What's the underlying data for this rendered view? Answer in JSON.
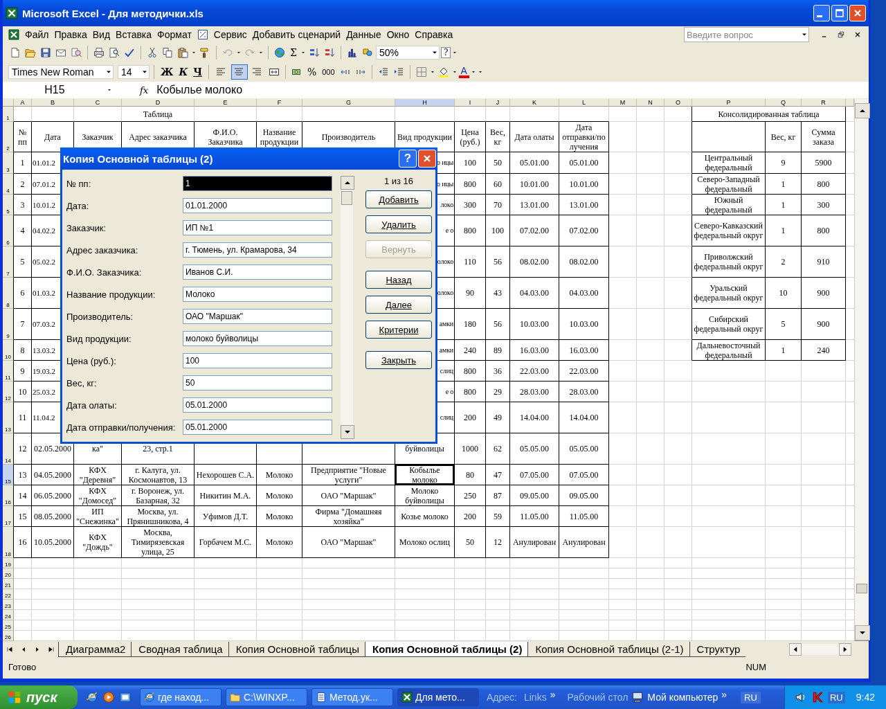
{
  "window": {
    "title": "Microsoft Excel - Для методички.xls"
  },
  "menu": [
    "Файл",
    "Правка",
    "Вид",
    "Вставка",
    "Формат",
    "Сервис",
    "Добавить сценарий",
    "Данные",
    "Окно",
    "Справка"
  ],
  "help_search": {
    "placeholder": "Введите вопрос"
  },
  "toolbar": {
    "sum": "Σ",
    "zoom": "50%",
    "help": "?",
    "font": "Times New Roman",
    "size": "14",
    "bold": "Ж",
    "italic": "К",
    "underline": "Ч",
    "percent": "%",
    "thousands": "000",
    "font_color": "A",
    "alignment": [
      {
        "kind": "left",
        "selected": false
      },
      {
        "kind": "center",
        "selected": true
      },
      {
        "kind": "right",
        "selected": false
      }
    ]
  },
  "formula_bar": {
    "name_box": "H15",
    "fx": "fx",
    "formula": "Кобылье молоко"
  },
  "sheet": {
    "columns": [
      {
        "label": "A",
        "selected": false
      },
      {
        "label": "B",
        "selected": false
      },
      {
        "label": "C",
        "selected": false
      },
      {
        "label": "D",
        "selected": false
      },
      {
        "label": "E",
        "selected": false
      },
      {
        "label": "F",
        "selected": false
      },
      {
        "label": "G",
        "selected": false
      },
      {
        "label": "H",
        "selected": true
      },
      {
        "label": "I",
        "selected": false
      },
      {
        "label": "J",
        "selected": false
      },
      {
        "label": "K",
        "selected": false
      },
      {
        "label": "L",
        "selected": false
      },
      {
        "label": "M",
        "selected": false
      },
      {
        "label": "N",
        "selected": false
      },
      {
        "label": "O",
        "selected": false
      },
      {
        "label": "P",
        "selected": false
      },
      {
        "label": "Q",
        "selected": false
      },
      {
        "label": "R",
        "selected": false
      }
    ],
    "rows": [
      {
        "label": "1",
        "selected": false,
        "cells": {
          "d": "Таблица",
          "p": "Консолидированная таблица"
        }
      },
      {
        "label": "2",
        "selected": false,
        "cells": {
          "a": "№ пп",
          "b": "Дата",
          "c": "Заказчик",
          "d": "Адрес заказчика",
          "e": "Ф.И.О. Заказчика",
          "f": "Название продукции",
          "g": "Производитель",
          "h": "Вид продукции",
          "i": "Цена (руб.)",
          "j": "Вес, кг",
          "k": "Дата олаты",
          "l": "Дата отправки/по лучения",
          "q": "Вес, кг",
          "r": "Сумма заказа"
        }
      },
      {
        "label": "3",
        "selected": false,
        "cells": {
          "a": "1",
          "b": "01.01.2",
          "h": "о ицы",
          "i": "100",
          "j": "50",
          "k": "05.01.00",
          "l": "05.01.00",
          "p": "Центральный федеральный",
          "q": "9",
          "r": "5900"
        }
      },
      {
        "label": "4",
        "selected": false,
        "cells": {
          "a": "2",
          "b": "07.01.2",
          "h": "о ицы",
          "i": "800",
          "j": "60",
          "k": "10.01.00",
          "l": "10.01.00",
          "p": "Северо-Западный федеральный",
          "q": "1",
          "r": "800"
        }
      },
      {
        "label": "5",
        "selected": false,
        "cells": {
          "a": "3",
          "b": "10.01.2",
          "h": "локо",
          "i": "300",
          "j": "70",
          "k": "13.01.00",
          "l": "13.01.00",
          "p": "Южный федеральный",
          "q": "1",
          "r": "300"
        }
      },
      {
        "label": "6",
        "selected": false,
        "cells": {
          "a": "4",
          "b": "04.02.2",
          "h": "е о",
          "i": "800",
          "j": "100",
          "k": "07.02.00",
          "l": "07.02.00",
          "p": "Северо-Кавказский федеральный округ",
          "q": "1",
          "r": "800"
        }
      },
      {
        "label": "7",
        "selected": false,
        "cells": {
          "a": "5",
          "b": "05.02.2",
          "h": "олоко",
          "i": "110",
          "j": "56",
          "k": "08.02.00",
          "l": "08.02.00",
          "p": "Приволжский федеральный округ",
          "q": "2",
          "r": "910"
        }
      },
      {
        "label": "8",
        "selected": false,
        "cells": {
          "a": "6",
          "b": "01.03.2",
          "h": "олоко",
          "i": "90",
          "j": "43",
          "k": "04.03.00",
          "l": "04.03.00",
          "p": "Уральский федеральный округ",
          "q": "10",
          "r": "900"
        }
      },
      {
        "label": "9",
        "selected": false,
        "cells": {
          "a": "7",
          "b": "07.03.2",
          "h": "амки",
          "i": "180",
          "j": "56",
          "k": "10.03.00",
          "l": "10.03.00",
          "p": "Сибирский федеральный округ",
          "q": "5",
          "r": "900"
        }
      },
      {
        "label": "10",
        "selected": false,
        "cells": {
          "a": "8",
          "b": "13.03.2",
          "h": "амки",
          "i": "240",
          "j": "89",
          "k": "16.03.00",
          "l": "16.03.00",
          "p": "Дальневосточный федеральный",
          "q": "1",
          "r": "240"
        }
      },
      {
        "label": "11",
        "selected": false,
        "cells": {
          "a": "9",
          "b": "19.03.2",
          "h": "слиц",
          "i": "800",
          "j": "36",
          "k": "22.03.00",
          "l": "22.03.00"
        }
      },
      {
        "label": "12",
        "selected": false,
        "cells": {
          "a": "10",
          "b": "25.03.2",
          "h": "е о",
          "i": "800",
          "j": "29",
          "k": "28.03.00",
          "l": "28.03.00"
        }
      },
      {
        "label": "13",
        "selected": false,
        "cells": {
          "a": "11",
          "b": "11.04.2",
          "h": "слиц",
          "i": "200",
          "j": "49",
          "k": "14.04.00",
          "l": "14.04.00"
        }
      },
      {
        "label": "14",
        "selected": false,
        "cells": {
          "a": "12",
          "b": "02.05.2000",
          "c": "ка\"",
          "d": "23, стр.1",
          "h": "буйволицы",
          "i": "1000",
          "j": "62",
          "k": "05.05.00",
          "l": "05.05.00"
        }
      },
      {
        "label": "15",
        "selected": true,
        "cells": {
          "a": "13",
          "b": "04.05.2000",
          "c": "КФХ \"Деревня\"",
          "d": "г. Калуга, ул. Космонавтов, 13",
          "e": "Нехорошев С.А.",
          "f": "Молоко",
          "g": "Предприятие \"Новые услуги\"",
          "h": "Кобылье молоко",
          "i": "80",
          "j": "47",
          "k": "07.05.00",
          "l": "07.05.00"
        }
      },
      {
        "label": "16",
        "selected": false,
        "cells": {
          "a": "14",
          "b": "06.05.2000",
          "c": "КФХ \"Домосед\"",
          "d": "г. Воронеж, ул. Базарная, 32",
          "e": "Никитин М.А.",
          "f": "Молоко",
          "g": "ОАО \"Маршак\"",
          "h": "Молоко буйволицы",
          "i": "250",
          "j": "87",
          "k": "09.05.00",
          "l": "09.05.00"
        }
      },
      {
        "label": "17",
        "selected": false,
        "cells": {
          "a": "15",
          "b": "08.05.2000",
          "c": "ИП \"Снежинка\"",
          "d": "Москва, ул. Прянишникова, 4",
          "e": "Уфимов Д.Т.",
          "f": "Молоко",
          "g": "Фирма \"Домашняя хозяйка\"",
          "h": "Козье молоко",
          "i": "200",
          "j": "59",
          "k": "11.05.00",
          "l": "11.05.00"
        }
      },
      {
        "label": "18",
        "selected": false,
        "cells": {
          "a": "16",
          "b": "10.05.2000",
          "c": "КФХ \"Дождь\"",
          "d": "Москва, Тимирязевская улица, 25",
          "e": "Горбачем М.С.",
          "f": "Молоко",
          "g": "ОАО \"Маршак\"",
          "h": "Молоко ослиц",
          "i": "50",
          "j": "12",
          "k": "Анулирован",
          "l": "Анулирован"
        }
      },
      {
        "label": "19",
        "selected": false
      },
      {
        "label": "20",
        "selected": false
      },
      {
        "label": "21",
        "selected": false
      },
      {
        "label": "22",
        "selected": false
      },
      {
        "label": "23",
        "selected": false
      },
      {
        "label": "24",
        "selected": false
      },
      {
        "label": "25",
        "selected": false
      },
      {
        "label": "26",
        "selected": false
      }
    ]
  },
  "dialog": {
    "title": "Копия Основной таблицы (2)",
    "help": "?",
    "counter": "1 из 16",
    "fields": [
      {
        "label": "№ пп:",
        "value": "1",
        "selected": true
      },
      {
        "label": "Дата:",
        "value": "01.01.2000",
        "selected": false
      },
      {
        "label": "Заказчик:",
        "value": "ИП №1",
        "selected": false
      },
      {
        "label": "Адрес заказчика:",
        "value": "г. Тюмень, ул. Крамарова, 34",
        "selected": false
      },
      {
        "label": "Ф.И.О. Заказчика:",
        "value": "Иванов С.И.",
        "selected": false
      },
      {
        "label": "Название продукции:",
        "value": "Молоко",
        "selected": false
      },
      {
        "label": "Производитель:",
        "value": "ОАО \"Маршак\"",
        "selected": false
      },
      {
        "label": "Вид продукции:",
        "value": "молоко буйволицы",
        "selected": false
      },
      {
        "label": "Цена (руб.):",
        "value": "100",
        "selected": false
      },
      {
        "label": "Вес, кг:",
        "value": "50",
        "selected": false
      },
      {
        "label": "Дата олаты:",
        "value": "05.01.2000",
        "selected": false
      },
      {
        "label": "Дата отправки/получения:",
        "value": "05.01.2000",
        "selected": false
      }
    ],
    "buttons": [
      {
        "label": "Добавить",
        "disabled": false
      },
      {
        "label": "Удалить",
        "disabled": false
      },
      {
        "label": "Вернуть",
        "disabled": true
      },
      {
        "label": "Назад",
        "disabled": false
      },
      {
        "label": "Далее",
        "disabled": false
      },
      {
        "label": "Критерии",
        "disabled": false
      },
      {
        "label": "Закрыть",
        "disabled": false
      }
    ]
  },
  "sheet_tabs": [
    {
      "label": "Диаграмма2",
      "selected": false
    },
    {
      "label": "Сводная таблица",
      "selected": false
    },
    {
      "label": "Копия Основной таблицы",
      "selected": false
    },
    {
      "label": "Копия Основной таблицы (2)",
      "selected": true
    },
    {
      "label": "Копия Основной таблицы (2-1)",
      "selected": false
    },
    {
      "label": "Структур",
      "selected": false
    }
  ],
  "status_bar": {
    "status": "Готово",
    "num": "NUM"
  },
  "taskbar": {
    "start": "пуск",
    "tasks": [
      {
        "kind": "browser",
        "label": "где наход...",
        "selected": false
      },
      {
        "kind": "folder",
        "label": "C:\\WINXP...",
        "selected": false
      },
      {
        "kind": "document",
        "label": "Метод.ук...",
        "selected": false
      },
      {
        "kind": "spreadsheet",
        "label": "Для мето...",
        "selected": true
      }
    ],
    "address": "Адрес:",
    "links": "Links",
    "more": "»",
    "desktop": "Рабочий стол",
    "computer": "Мой компьютер",
    "more2": "»",
    "lang_bar": "RU",
    "tray_lang": "RU",
    "clock": "9:42"
  }
}
